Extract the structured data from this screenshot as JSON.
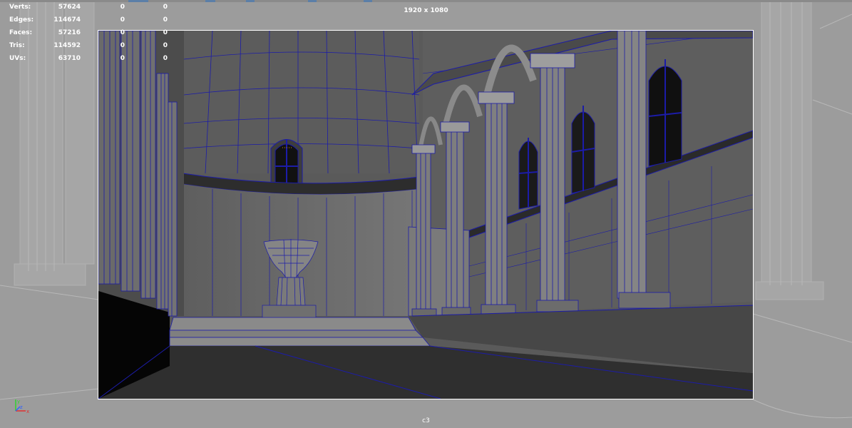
{
  "hud": {
    "rows": [
      {
        "label": "Verts:",
        "v1": "57624",
        "v2": "0",
        "v3": "0"
      },
      {
        "label": "Edges:",
        "v1": "114674",
        "v2": "0",
        "v3": "0"
      },
      {
        "label": "Faces:",
        "v1": "57216",
        "v2": "0",
        "v3": "0"
      },
      {
        "label": "Tris:",
        "v1": "114592",
        "v2": "0",
        "v3": "0"
      },
      {
        "label": "UVs:",
        "v1": "63710",
        "v2": "0",
        "v3": "0"
      }
    ]
  },
  "viewport": {
    "resolution_label": "1920 x 1080",
    "camera_name": "c3",
    "wireframe_color": "#1c1ca8",
    "background_color": "#9b9b9b",
    "shaded_color": "#6e6e6e"
  },
  "axis_gizmo": {
    "y_label": "y",
    "z_label": "z",
    "x_label": "x"
  }
}
